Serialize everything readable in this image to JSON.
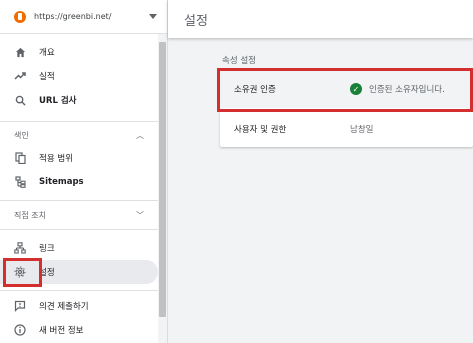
{
  "property": {
    "url": "https://greenbi.net/"
  },
  "nav": {
    "overview": "개요",
    "performance": "실적",
    "url_inspection": "URL 검사",
    "index_header": "색인",
    "coverage": "적용 범위",
    "sitemaps": "Sitemaps",
    "manual_actions_header": "직접 조치",
    "links": "링크",
    "settings": "설정",
    "feedback": "의견 제출하기",
    "new_version": "새 버전 정보"
  },
  "header": {
    "title": "설정"
  },
  "settings": {
    "section_title": "속성 설정",
    "rows": [
      {
        "key": "소유권 인증",
        "value": "인증된 소유자입니다."
      },
      {
        "key": "사용자 및 권한",
        "value": "남창일"
      }
    ]
  },
  "colors": {
    "highlight": "#d32f2f",
    "verified": "#188038",
    "favicon": "#ef6c00"
  },
  "icons": {
    "overview": "home-icon",
    "performance": "trending-up-icon",
    "url_inspection": "search-icon",
    "coverage": "copy-icon",
    "sitemaps": "sitemap-icon",
    "links": "links-icon",
    "settings": "gear-icon",
    "feedback": "feedback-icon",
    "new_version": "info-icon"
  }
}
